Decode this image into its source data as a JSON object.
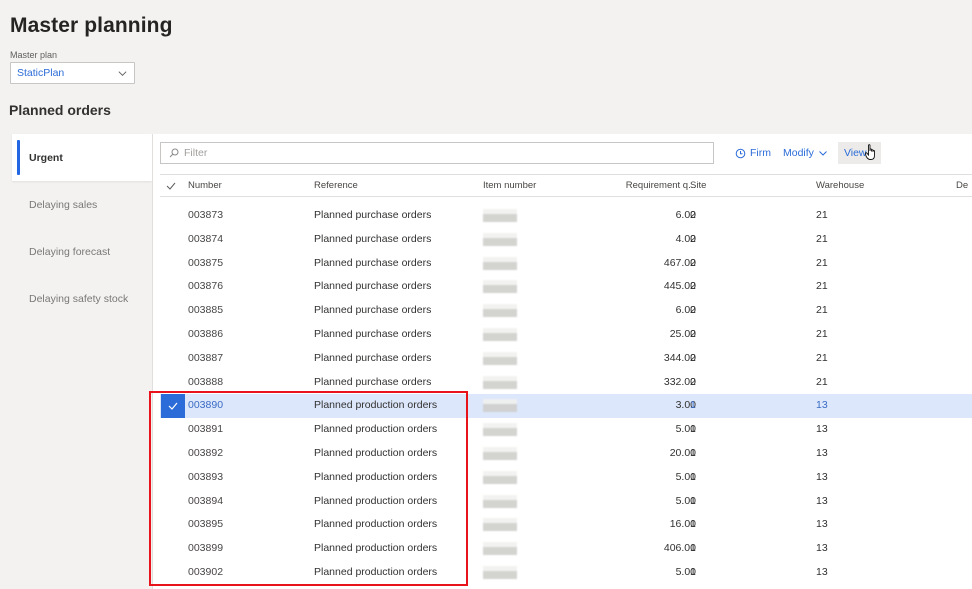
{
  "page": {
    "title": "Master planning",
    "master_plan_label": "Master plan",
    "master_plan_value": "StaticPlan",
    "section_title": "Planned orders"
  },
  "tabs": [
    {
      "label": "Urgent",
      "active": true
    },
    {
      "label": "Delaying sales",
      "active": false
    },
    {
      "label": "Delaying forecast",
      "active": false
    },
    {
      "label": "Delaying safety stock",
      "active": false
    }
  ],
  "toolbar": {
    "filter_placeholder": "Filter",
    "firm_label": "Firm",
    "modify_label": "Modify",
    "view_label": "View"
  },
  "grid": {
    "columns": {
      "number": "Number",
      "reference": "Reference",
      "item_number": "Item number",
      "requirement_qty": "Requirement q...",
      "site": "Site",
      "warehouse": "Warehouse",
      "truncated": "De"
    },
    "rows": [
      {
        "number": "003873",
        "reference": "Planned purchase orders",
        "item_number": "[redacted]",
        "qty": "6.00",
        "site": "2",
        "warehouse": "21",
        "selected": false
      },
      {
        "number": "003874",
        "reference": "Planned purchase orders",
        "item_number": "[redacted]",
        "qty": "4.00",
        "site": "2",
        "warehouse": "21",
        "selected": false
      },
      {
        "number": "003875",
        "reference": "Planned purchase orders",
        "item_number": "[redacted]",
        "qty": "467.00",
        "site": "2",
        "warehouse": "21",
        "selected": false
      },
      {
        "number": "003876",
        "reference": "Planned purchase orders",
        "item_number": "[redacted]",
        "qty": "445.00",
        "site": "2",
        "warehouse": "21",
        "selected": false
      },
      {
        "number": "003885",
        "reference": "Planned purchase orders",
        "item_number": "[redacted]",
        "qty": "6.00",
        "site": "2",
        "warehouse": "21",
        "selected": false
      },
      {
        "number": "003886",
        "reference": "Planned purchase orders",
        "item_number": "[redacted]",
        "qty": "25.00",
        "site": "2",
        "warehouse": "21",
        "selected": false
      },
      {
        "number": "003887",
        "reference": "Planned purchase orders",
        "item_number": "[redacted]",
        "qty": "344.00",
        "site": "2",
        "warehouse": "21",
        "selected": false
      },
      {
        "number": "003888",
        "reference": "Planned purchase orders",
        "item_number": "[redacted]",
        "qty": "332.00",
        "site": "2",
        "warehouse": "21",
        "selected": false
      },
      {
        "number": "003890",
        "reference": "Planned production orders",
        "item_number": "[redacted]",
        "qty": "3.00",
        "site": "1",
        "warehouse": "13",
        "selected": true
      },
      {
        "number": "003891",
        "reference": "Planned production orders",
        "item_number": "[redacted]",
        "qty": "5.00",
        "site": "1",
        "warehouse": "13",
        "selected": false
      },
      {
        "number": "003892",
        "reference": "Planned production orders",
        "item_number": "[redacted]",
        "qty": "20.00",
        "site": "1",
        "warehouse": "13",
        "selected": false
      },
      {
        "number": "003893",
        "reference": "Planned production orders",
        "item_number": "[redacted]",
        "qty": "5.00",
        "site": "1",
        "warehouse": "13",
        "selected": false
      },
      {
        "number": "003894",
        "reference": "Planned production orders",
        "item_number": "[redacted]",
        "qty": "5.00",
        "site": "1",
        "warehouse": "13",
        "selected": false
      },
      {
        "number": "003895",
        "reference": "Planned production orders",
        "item_number": "[redacted]",
        "qty": "16.00",
        "site": "1",
        "warehouse": "13",
        "selected": false
      },
      {
        "number": "003899",
        "reference": "Planned production orders",
        "item_number": "[redacted]",
        "qty": "406.00",
        "site": "1",
        "warehouse": "13",
        "selected": false
      },
      {
        "number": "003902",
        "reference": "Planned production orders",
        "item_number": "[redacted]",
        "qty": "5.00",
        "site": "1",
        "warehouse": "13",
        "selected": false
      }
    ]
  },
  "colors": {
    "accent": "#2b6cd8",
    "selected_row": "#dce7fb",
    "annotation_box": "#e8141b"
  }
}
